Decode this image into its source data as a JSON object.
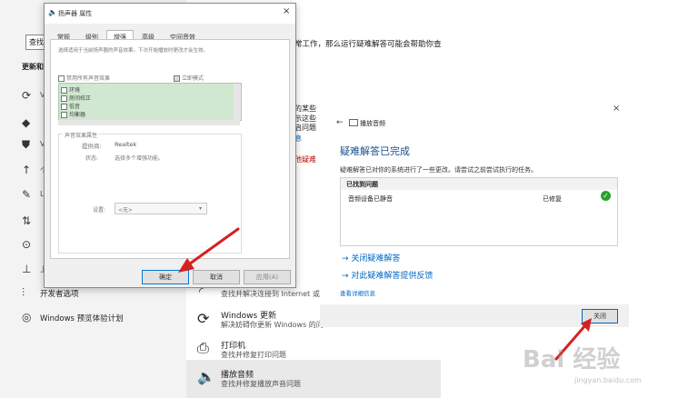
{
  "settings": {
    "search_placeholder": "查找",
    "nav_heading": "更新和",
    "nav_glyphs": [
      "V",
      "V",
      "个",
      "L",
      "上"
    ],
    "developer_options": "开发者选项",
    "insider_program": "Windows 预览体验计划",
    "intro_text": "常工作，那么运行疑难解答可能会帮助你查",
    "partial_lines": [
      "的某些",
      "示这些",
      "启问题",
      "息"
    ],
    "partial_red": "他疑难",
    "list_items": [
      {
        "title": "",
        "subtitle": "查找并解决连接到 Internet 或",
        "icon": "wifi-icon"
      },
      {
        "title": "Windows 更新",
        "subtitle": "解决妨碍你更新 Windows 的问",
        "icon": "refresh-icon"
      },
      {
        "title": "打印机",
        "subtitle": "查找并修复打印问题",
        "icon": "printer-icon"
      },
      {
        "title": "播放音频",
        "subtitle": "查找并修复播放声音问题",
        "icon": "speaker-icon"
      }
    ]
  },
  "sound_dialog": {
    "title": "扬声器 属性",
    "tabs": [
      "常规",
      "级别",
      "增强",
      "高级",
      "空间音效"
    ],
    "active_tab": 2,
    "description": "选择适用于当前扬声器的声音效果。下次开始播放时更改才会生效。",
    "disable_all_label": "禁用所有声音效果",
    "immediate_mode_label": "立即模式",
    "effects": [
      "环境",
      "房间校正",
      "低音",
      "均衡器"
    ],
    "props_header": "声音效果属性",
    "provider_label": "提供商:",
    "provider_value": "Realtek",
    "status_label": "状态:",
    "status_value": "选择多个增强功能。",
    "settings_label": "设置:",
    "settings_value": "<无>",
    "buttons": {
      "ok": "确定",
      "cancel": "取消",
      "apply": "应用(A)"
    }
  },
  "troubleshooter": {
    "title": "播放音频",
    "heading": "疑难解答已完成",
    "description": "疑难解答已对你的系统进行了一些更改。请尝试之前尝试执行的任务。",
    "table_header": "已找到问题",
    "problem": "音频设备已静音",
    "status": "已修复",
    "link_close": "→ 关闭疑难解答",
    "link_feedback": "→ 对此疑难解答提供反馈",
    "details": "查看详细信息",
    "close_button": "关闭"
  },
  "watermark": {
    "main": "Bai 经验",
    "url": "jingyan.baidu.com"
  }
}
